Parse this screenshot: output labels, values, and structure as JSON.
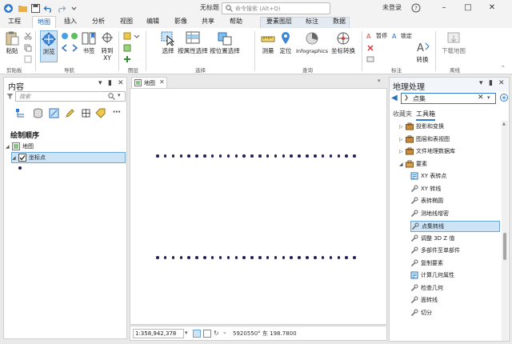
{
  "window": {
    "title": "无标题",
    "command_search_placeholder": "命令搜索 (Alt+Q)",
    "login": "未登录",
    "help": "?"
  },
  "tabs": [
    {
      "label": "工程"
    },
    {
      "label": "地图"
    },
    {
      "label": "插入"
    },
    {
      "label": "分析"
    },
    {
      "label": "视图"
    },
    {
      "label": "编辑"
    },
    {
      "label": "影像"
    },
    {
      "label": "共享"
    },
    {
      "label": "帮助"
    },
    {
      "label": "要素图层"
    },
    {
      "label": "标注"
    },
    {
      "label": "数据"
    }
  ],
  "ribbon": {
    "paste": "粘贴",
    "explore": "浏览",
    "bookmarks": "书签",
    "goto_xy": "转到\nXY",
    "select": "选择",
    "select_by_attr": "按属性选择",
    "select_by_loc": "按位置选择",
    "measure": "测量",
    "locate": "定位",
    "infographics": "Infographics",
    "convert_coords": "坐标转换",
    "pause": "暂停",
    "lock": "锁定",
    "convert": "转换",
    "download_map": "下载地图",
    "groups": {
      "clipboard": "剪贴板",
      "navigate": "导航",
      "layer": "图层",
      "selection": "选择",
      "inquiry": "查询",
      "labeling": "标注",
      "offline": "离线"
    }
  },
  "contents": {
    "title": "内容",
    "search_placeholder": "搜索",
    "drawing_order": "绘制顺序",
    "map_node": "地图",
    "layer": "坐标点"
  },
  "map": {
    "tab_label": "地图",
    "scale": "1:358,942,378",
    "coords": "5920550° 东 198.7800"
  },
  "geoprocessing": {
    "title": "地理处理",
    "search_value": "点集",
    "tab_favorites": "收藏夹",
    "tab_toolboxes": "工具箱",
    "items": [
      {
        "label": "投影和变换",
        "kind": "toolbox"
      },
      {
        "label": "图层和表视图",
        "kind": "toolbox"
      },
      {
        "label": "文件地理数据库",
        "kind": "toolbox"
      },
      {
        "label": "要素",
        "kind": "toolbox-open"
      },
      {
        "label": "XY 表转点",
        "kind": "script"
      },
      {
        "label": "XY 转线",
        "kind": "tool"
      },
      {
        "label": "表转椭圆",
        "kind": "tool"
      },
      {
        "label": "测地线增密",
        "kind": "tool"
      },
      {
        "label": "点集转线",
        "kind": "tool",
        "selected": true
      },
      {
        "label": "调整 3D Z 值",
        "kind": "tool"
      },
      {
        "label": "多部件至单部件",
        "kind": "tool"
      },
      {
        "label": "复制要素",
        "kind": "tool"
      },
      {
        "label": "计算几何属性",
        "kind": "script"
      },
      {
        "label": "检查几何",
        "kind": "tool"
      },
      {
        "label": "面转线",
        "kind": "tool"
      },
      {
        "label": "切分",
        "kind": "tool"
      }
    ]
  },
  "colors": {
    "accent": "#1f5fa8",
    "selection": "#cde4f7",
    "point": "#2b1d5a"
  }
}
